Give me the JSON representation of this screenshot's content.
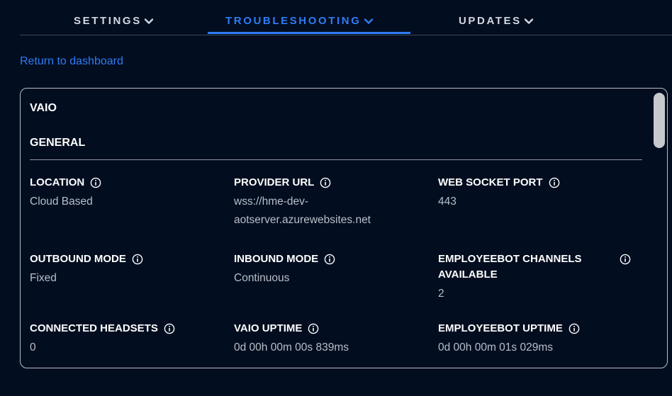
{
  "nav": {
    "tabs": [
      {
        "label": "SETTINGS",
        "active": false
      },
      {
        "label": "TROUBLESHOOTING",
        "active": true
      },
      {
        "label": "UPDATES",
        "active": false
      }
    ],
    "chevron_icon": "chevron-down-icon"
  },
  "return_link": "Return to dashboard",
  "card": {
    "device_name": "VAIO",
    "section_title": "GENERAL",
    "fields": [
      {
        "label": "LOCATION",
        "value": "Cloud Based"
      },
      {
        "label": "PROVIDER URL",
        "value": "wss://hme-dev-aotserver.azurewebsites.net"
      },
      {
        "label": "WEB SOCKET PORT",
        "value": "443"
      },
      {
        "label": "OUTBOUND MODE",
        "value": "Fixed"
      },
      {
        "label": "INBOUND MODE",
        "value": "Continuous"
      },
      {
        "label": "EMPLOYEEBOT CHANNELS AVAILABLE",
        "value": "2"
      },
      {
        "label": "CONNECTED HEADSETS",
        "value": "0"
      },
      {
        "label": "VAIO UPTIME",
        "value": "0d 00h 00m 00s 839ms"
      },
      {
        "label": "EMPLOYEEBOT UPTIME",
        "value": "0d 00h 00m 01s 029ms"
      }
    ],
    "info_icon": "info-icon"
  },
  "colors": {
    "background": "#020d1f",
    "accent": "#2f7cf6",
    "label": "#ffffff",
    "value": "#b8bfca",
    "border": "#b8bec8"
  }
}
